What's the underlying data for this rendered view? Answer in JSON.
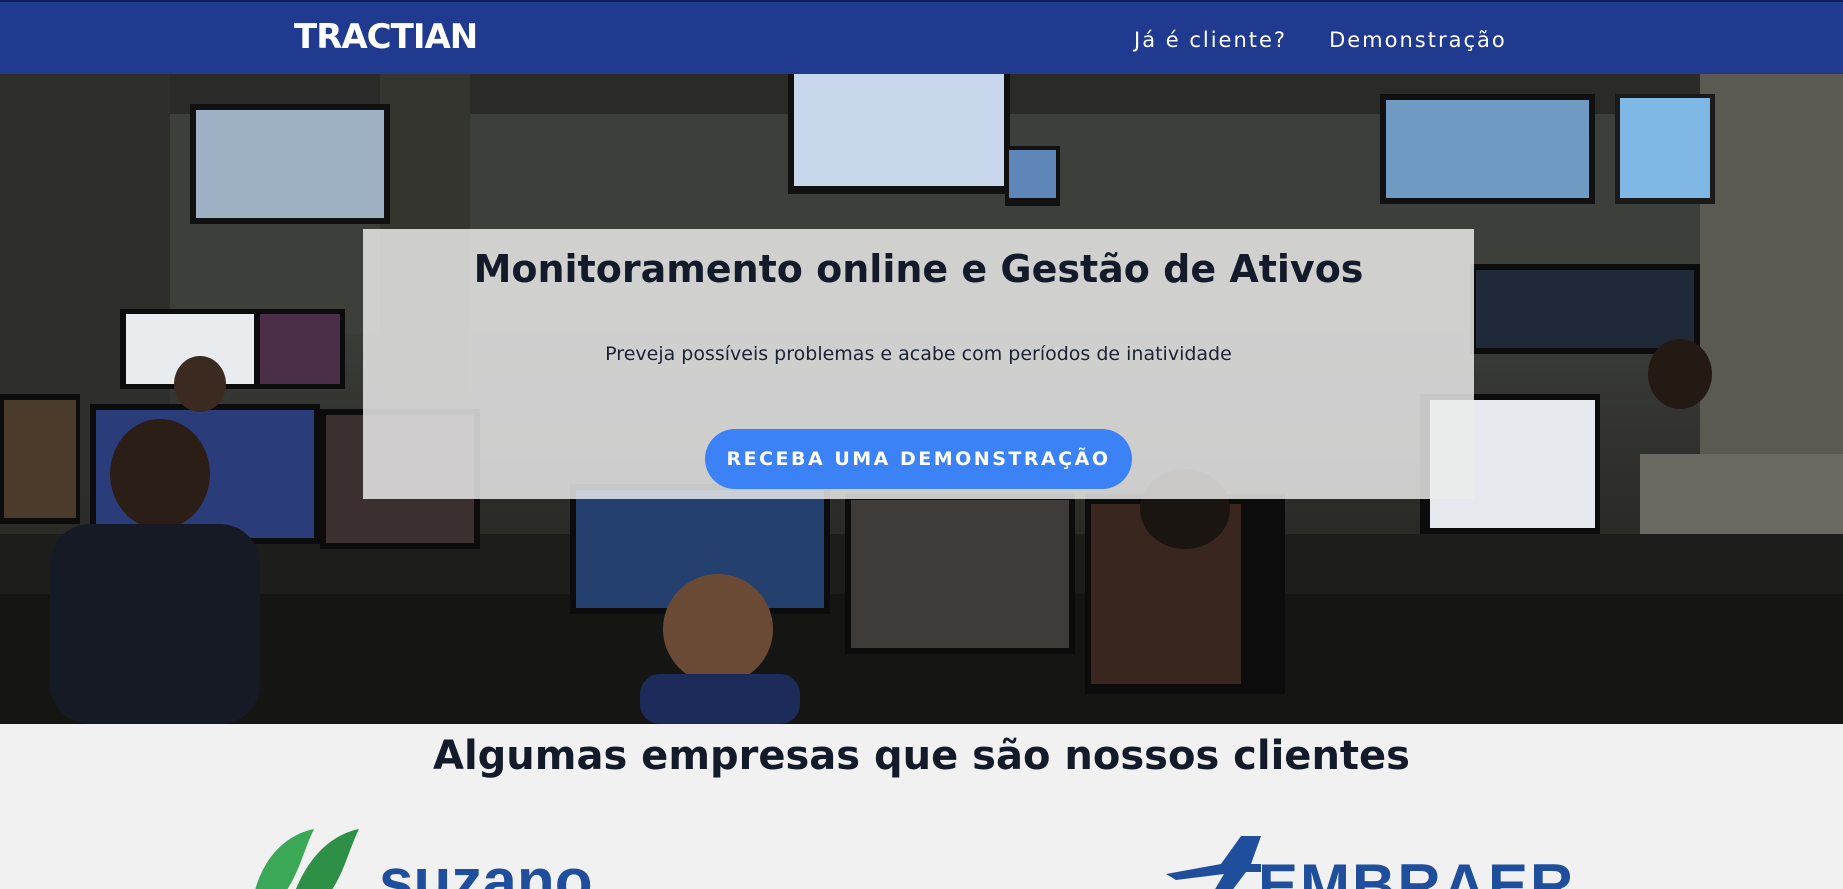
{
  "navbar": {
    "logo_text": "TRACTIAN",
    "links": [
      {
        "label": "Já é cliente?"
      },
      {
        "label": "Demonstração"
      }
    ],
    "background_color": "#1f3a8f"
  },
  "hero": {
    "title": "Monitoramento online e Gestão de Ativos",
    "subtitle": "Preveja possíveis problemas e acabe com períodos de inatividade",
    "cta_label": "RECEBA UMA DEMONSTRAÇÃO",
    "cta_color": "#3b82f6",
    "background_image": "control-room-photo"
  },
  "clients": {
    "title": "Algumas empresas que são nossos clientes",
    "logos": [
      {
        "name": "suzano",
        "text": "suzano",
        "color": "#1f4e9c",
        "leaf_color": "#2ea44f"
      },
      {
        "name": "embraer",
        "text": "EMBRAER",
        "color": "#1f4e9c"
      }
    ]
  }
}
